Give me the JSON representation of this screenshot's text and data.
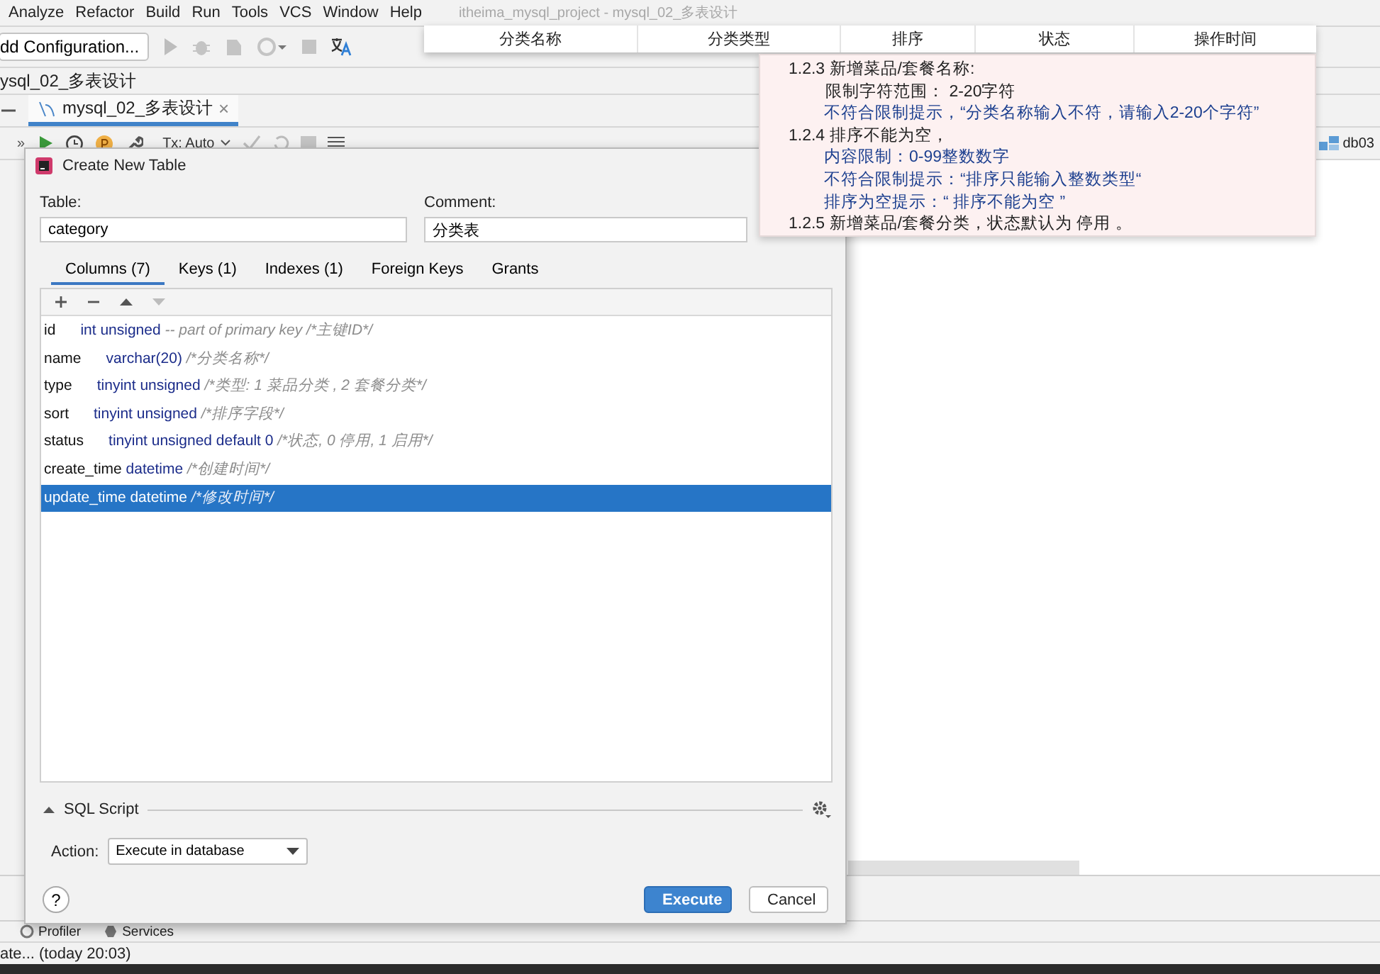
{
  "menu": [
    "Analyze",
    "Refactor",
    "Build",
    "Run",
    "Tools",
    "VCS",
    "Window",
    "Help"
  ],
  "window_title": "itheima_mysql_project - mysql_02_多表设计",
  "toolbar": {
    "run_config": "dd Configuration..."
  },
  "breadcrumb": "ysql_02_多表设计",
  "editor_tab": {
    "label": "mysql_02_多表设计",
    "close": "×",
    "selected": true
  },
  "editor_toolbar": {
    "more": "»",
    "tx_mode": "Tx: Auto",
    "datasource": "db03"
  },
  "dialog": {
    "title": "Create New Table",
    "table_label": "Table:",
    "table_value": "category",
    "comment_label": "Comment:",
    "comment_value": "分类表",
    "tabs": [
      {
        "label": "Columns (7)",
        "selected": true
      },
      {
        "label": "Keys (1)",
        "selected": false
      },
      {
        "label": "Indexes (1)",
        "selected": false
      },
      {
        "label": "Foreign Keys",
        "selected": false
      },
      {
        "label": "Grants",
        "selected": false
      }
    ],
    "column_actions": [
      {
        "kind": "add",
        "disabled": false
      },
      {
        "kind": "remove",
        "disabled": false
      },
      {
        "kind": "up",
        "disabled": false
      },
      {
        "kind": "down",
        "disabled": true
      }
    ],
    "columns": [
      {
        "name": "id",
        "type": "int unsigned",
        "comment": "-- part of primary key /*主键ID*/",
        "selected": false
      },
      {
        "name": "name",
        "type": "varchar(20)",
        "comment": "/*分类名称*/",
        "selected": false
      },
      {
        "name": "type",
        "type": "tinyint unsigned",
        "comment": "/*类型: 1 菜品分类 , 2 套餐分类*/",
        "selected": false
      },
      {
        "name": "sort",
        "type": "tinyint unsigned",
        "comment": "/*排序字段*/",
        "selected": false
      },
      {
        "name": "status",
        "type": "tinyint unsigned default 0",
        "comment": "/*状态, 0 停用, 1 启用*/",
        "selected": false
      },
      {
        "name": "create_time",
        "type": "datetime",
        "comment": "/*创建时间*/",
        "selected": false
      },
      {
        "name": "update_time",
        "type": "datetime",
        "comment": "/*修改时间*/",
        "selected": true
      }
    ],
    "sql_section": {
      "title": "SQL Script",
      "expanded": true
    },
    "action_label": "Action:",
    "action_value": "Execute in database",
    "help": "?",
    "buttons": [
      {
        "label": "Execute",
        "kind": "primary"
      },
      {
        "label": "Cancel",
        "kind": "secondary"
      }
    ]
  },
  "tool_windows": [
    "Profiler",
    "Services"
  ],
  "status_bar": "ate... (today 20:03)",
  "overlay_table_header": [
    "分类名称",
    "分类类型",
    "排序",
    "状态",
    "操作时间"
  ],
  "overlay_note": [
    {
      "kind": "heading",
      "text": "1.2.3 新增菜品/套餐名称:"
    },
    {
      "kind": "detail",
      "text": "限制字符范围： 2-20字符"
    },
    {
      "kind": "hint",
      "text": "不符合限制提示，“分类名称输入不符，请输入2-20个字符”"
    },
    {
      "kind": "heading",
      "text": "1.2.4 排序不能为空，"
    },
    {
      "kind": "hint",
      "text": "内容限制：0-99整数数字"
    },
    {
      "kind": "hint",
      "text": "不符合限制提示：“排序只能输入整数类型“"
    },
    {
      "kind": "hint",
      "text": "排序为空提示：“ 排序不能为空 ”"
    },
    {
      "kind": "heading",
      "text": "1.2.5 新增菜品/套餐分类，状态默认为 停用 。"
    }
  ]
}
